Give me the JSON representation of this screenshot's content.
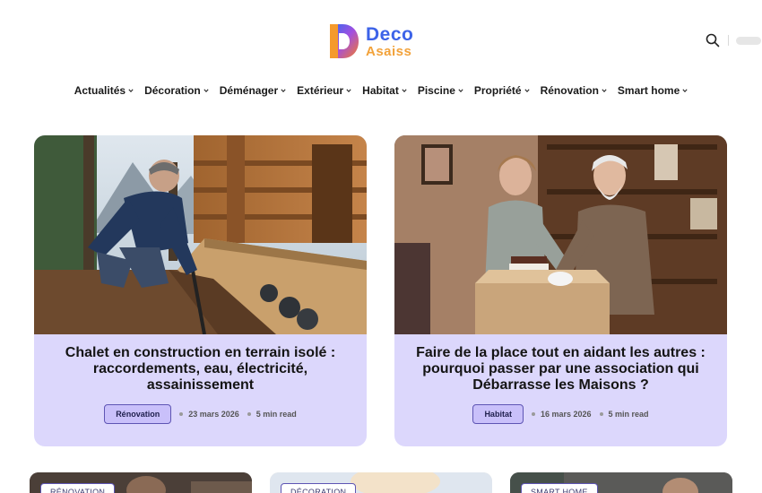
{
  "brand": {
    "line1": "Deco",
    "line2": "Asaiss"
  },
  "header": {
    "search_icon": "search-icon"
  },
  "nav": [
    {
      "label": "Actualités"
    },
    {
      "label": "Décoration"
    },
    {
      "label": "Déménager"
    },
    {
      "label": "Extérieur"
    },
    {
      "label": "Habitat"
    },
    {
      "label": "Piscine"
    },
    {
      "label": "Propriété"
    },
    {
      "label": "Rénovation"
    },
    {
      "label": "Smart home"
    }
  ],
  "featured": [
    {
      "title": "Chalet en construction en terrain isolé : raccordements, eau, électricité, assainissement",
      "category": "Rénovation",
      "date": "23 mars 2026",
      "read": "5 min read"
    },
    {
      "title": "Faire de la place tout en aidant les autres : pourquoi passer par une association qui Débarrasse les Maisons ?",
      "category": "Habitat",
      "date": "16 mars 2026",
      "read": "5 min read"
    }
  ],
  "more": [
    {
      "category": "RÉNOVATION"
    },
    {
      "category": "DÉCORATION"
    },
    {
      "category": "SMART HOME"
    }
  ],
  "colors": {
    "card_bg": "#dcd7fc",
    "badge_bg": "#c9c0fa",
    "accent": "#5e55b4"
  }
}
